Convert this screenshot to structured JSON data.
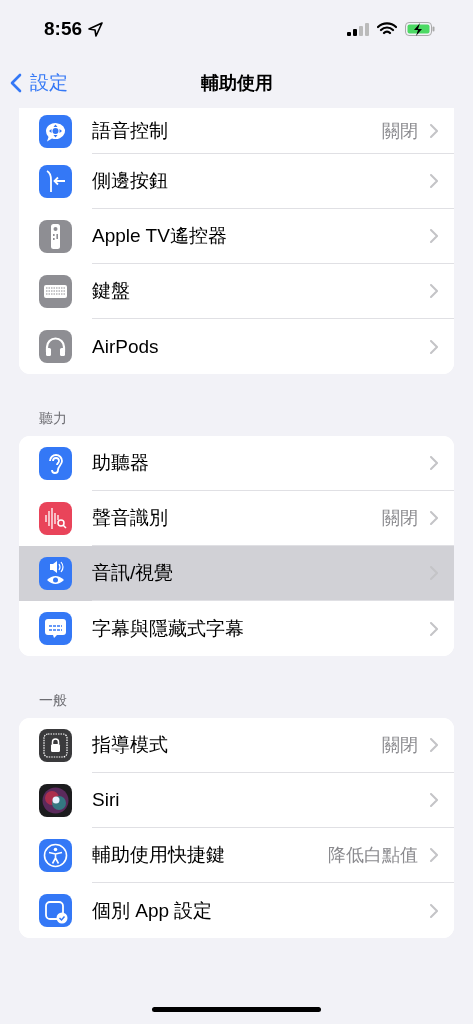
{
  "status_bar": {
    "time": "8:56"
  },
  "nav": {
    "back": "設定",
    "title": "輔助使用"
  },
  "groups": [
    {
      "rows": [
        {
          "label": "語音控制",
          "value": "關閉",
          "selected": false
        },
        {
          "label": "側邊按鈕",
          "selected": false
        },
        {
          "label": "Apple TV遙控器",
          "selected": false
        },
        {
          "label": "鍵盤",
          "selected": false
        },
        {
          "label": "AirPods",
          "selected": false
        }
      ]
    },
    {
      "header": "聽力",
      "rows": [
        {
          "label": "助聽器",
          "selected": false
        },
        {
          "label": "聲音識別",
          "value": "關閉",
          "selected": false
        },
        {
          "label": "音訊/視覺",
          "selected": true
        },
        {
          "label": "字幕與隱藏式字幕",
          "selected": false
        }
      ]
    },
    {
      "header": "一般",
      "rows": [
        {
          "label": "指導模式",
          "value": "關閉",
          "selected": false
        },
        {
          "label": "Siri",
          "selected": false
        },
        {
          "label": "輔助使用快捷鍵",
          "value": "降低白點值",
          "selected": false
        },
        {
          "label": "個別 App 設定",
          "selected": false
        }
      ]
    }
  ]
}
